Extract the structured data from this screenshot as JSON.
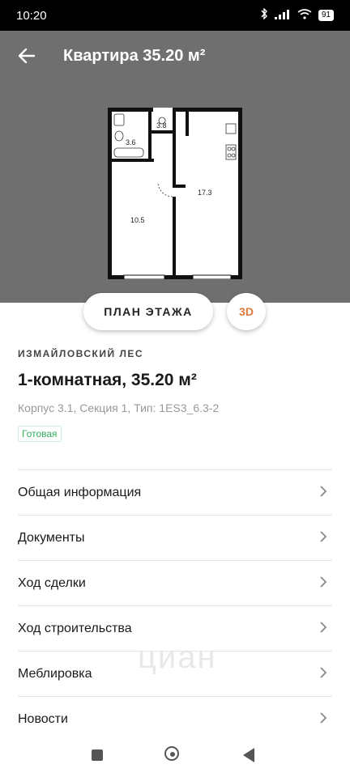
{
  "status": {
    "time": "10:20",
    "battery": "91"
  },
  "header": {
    "title": "Квартира 35.20 м²"
  },
  "plan": {
    "rooms": [
      "3.6",
      "3.8",
      "17.3",
      "10.5"
    ]
  },
  "tabs": {
    "plan_label": "ПЛАН ЭТАЖА",
    "three_d_label": "3D"
  },
  "apartment": {
    "complex": "ИЗМАЙЛОВСКИЙ ЛЕС",
    "title": "1-комнатная, 35.20 м²",
    "details": "Корпус 3.1, Секция 1, Тип: 1ES3_6.3-2",
    "status": "Готовая"
  },
  "menu": {
    "items": [
      {
        "label": "Общая информация"
      },
      {
        "label": "Документы"
      },
      {
        "label": "Ход сделки"
      },
      {
        "label": "Ход строительства"
      },
      {
        "label": "Меблировка"
      },
      {
        "label": "Новости"
      }
    ]
  },
  "watermark": "циан",
  "colors": {
    "hero": "#6f6f6f",
    "accent": "#e07a3a",
    "ready": "#33b05b"
  }
}
